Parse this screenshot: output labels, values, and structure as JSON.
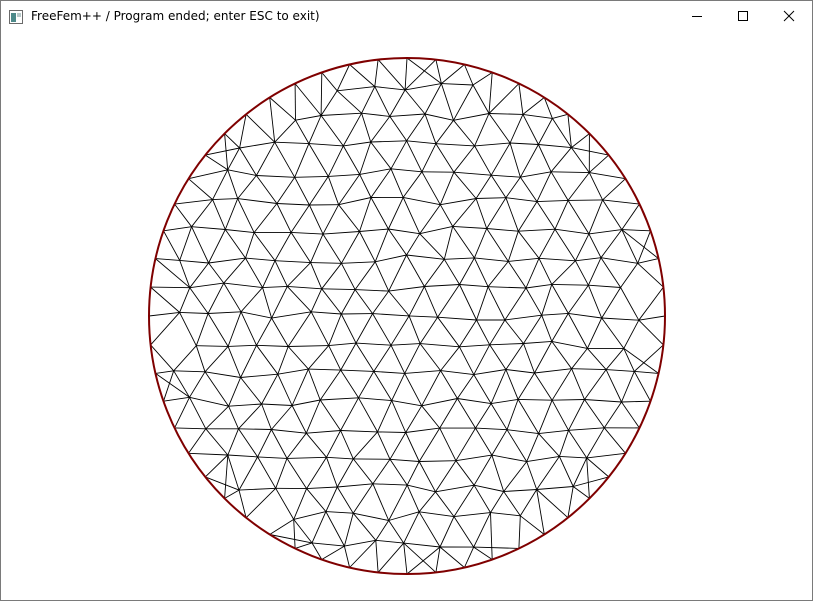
{
  "window": {
    "title": "FreeFem++ / Program ended; enter ESC to exit)",
    "app_icon": "freefem-window-icon",
    "controls": [
      "minimize-icon",
      "maximize-icon",
      "close-icon"
    ]
  },
  "plot": {
    "content": "triangular finite element mesh of a disk",
    "boundary_color": "#7f0000",
    "edge_color": "#000000",
    "background": "#ffffff"
  }
}
